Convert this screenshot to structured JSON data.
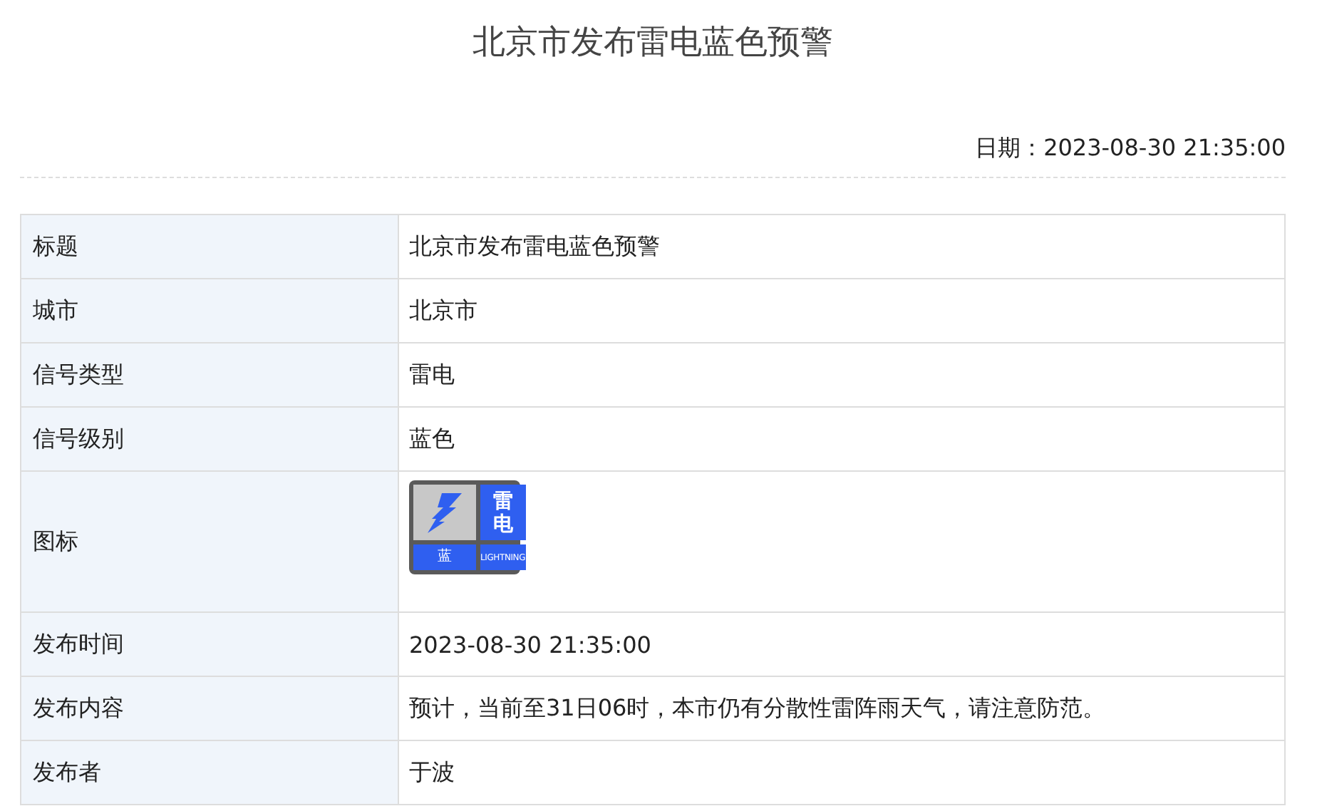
{
  "title": "北京市发布雷电蓝色预警",
  "date": {
    "label": "日期：",
    "value": "2023-08-30 21:35:00"
  },
  "table": {
    "rows": [
      {
        "label": "标题",
        "kind": "text",
        "value": "北京市发布雷电蓝色预警"
      },
      {
        "label": "城市",
        "kind": "text",
        "value": "北京市"
      },
      {
        "label": "信号类型",
        "kind": "text",
        "value": "雷电"
      },
      {
        "label": "信号级别",
        "kind": "text",
        "value": "蓝色"
      },
      {
        "label": "图标",
        "kind": "signal",
        "signal": {
          "type_chars": [
            "雷",
            "电"
          ],
          "level_char": "蓝",
          "english": "LIGHTNING",
          "color": "#2f5ff0"
        }
      },
      {
        "label": "发布时间",
        "kind": "text",
        "value": "2023-08-30 21:35:00"
      },
      {
        "label": "发布内容",
        "kind": "text",
        "value": "预计，当前至31日06时，本市仍有分散性雷阵雨天气，请注意防范。"
      },
      {
        "label": "发布者",
        "kind": "text",
        "value": "于波"
      }
    ]
  }
}
